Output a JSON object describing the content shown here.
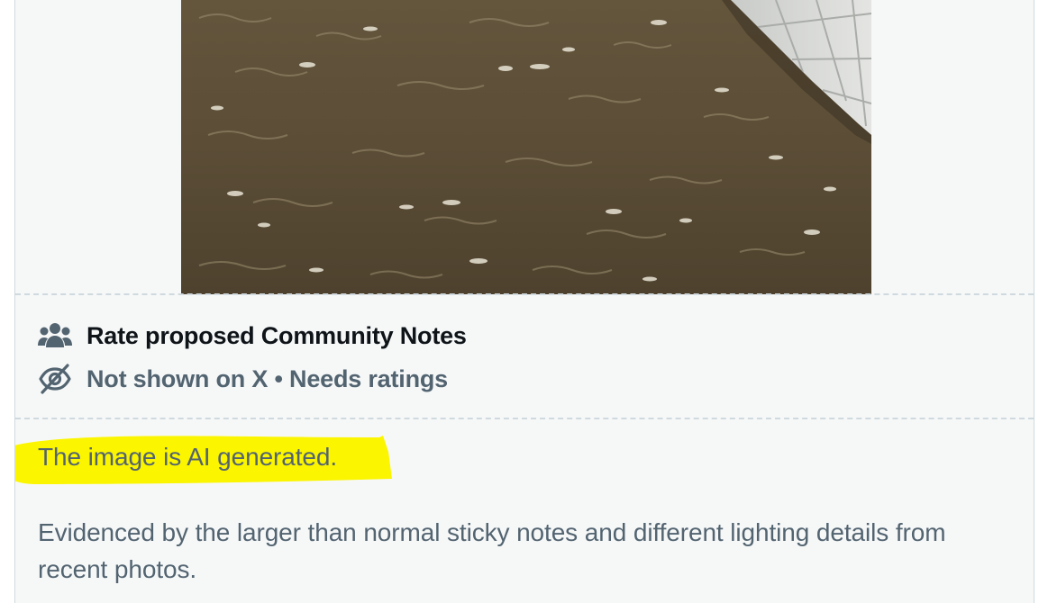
{
  "post": {
    "media_alt": "Photo of murky brown floodwater next to a pale tiled wall"
  },
  "community_notes": {
    "rate_label": "Rate proposed Community Notes",
    "status_label": "Not shown on X • Needs ratings",
    "note_summary": "The image is AI generated.",
    "note_body": "Evidenced by the larger than normal sticky notes and different lighting details from recent photos."
  },
  "colors": {
    "primary_text": "#0f1419",
    "secondary_text": "#536471",
    "card_background": "#f6f8f8",
    "border": "#cfd9de",
    "highlight": "#fbf500",
    "water": "#5a4c35"
  },
  "icons": {
    "rate": "people-group-icon",
    "status": "eye-slash-icon"
  }
}
